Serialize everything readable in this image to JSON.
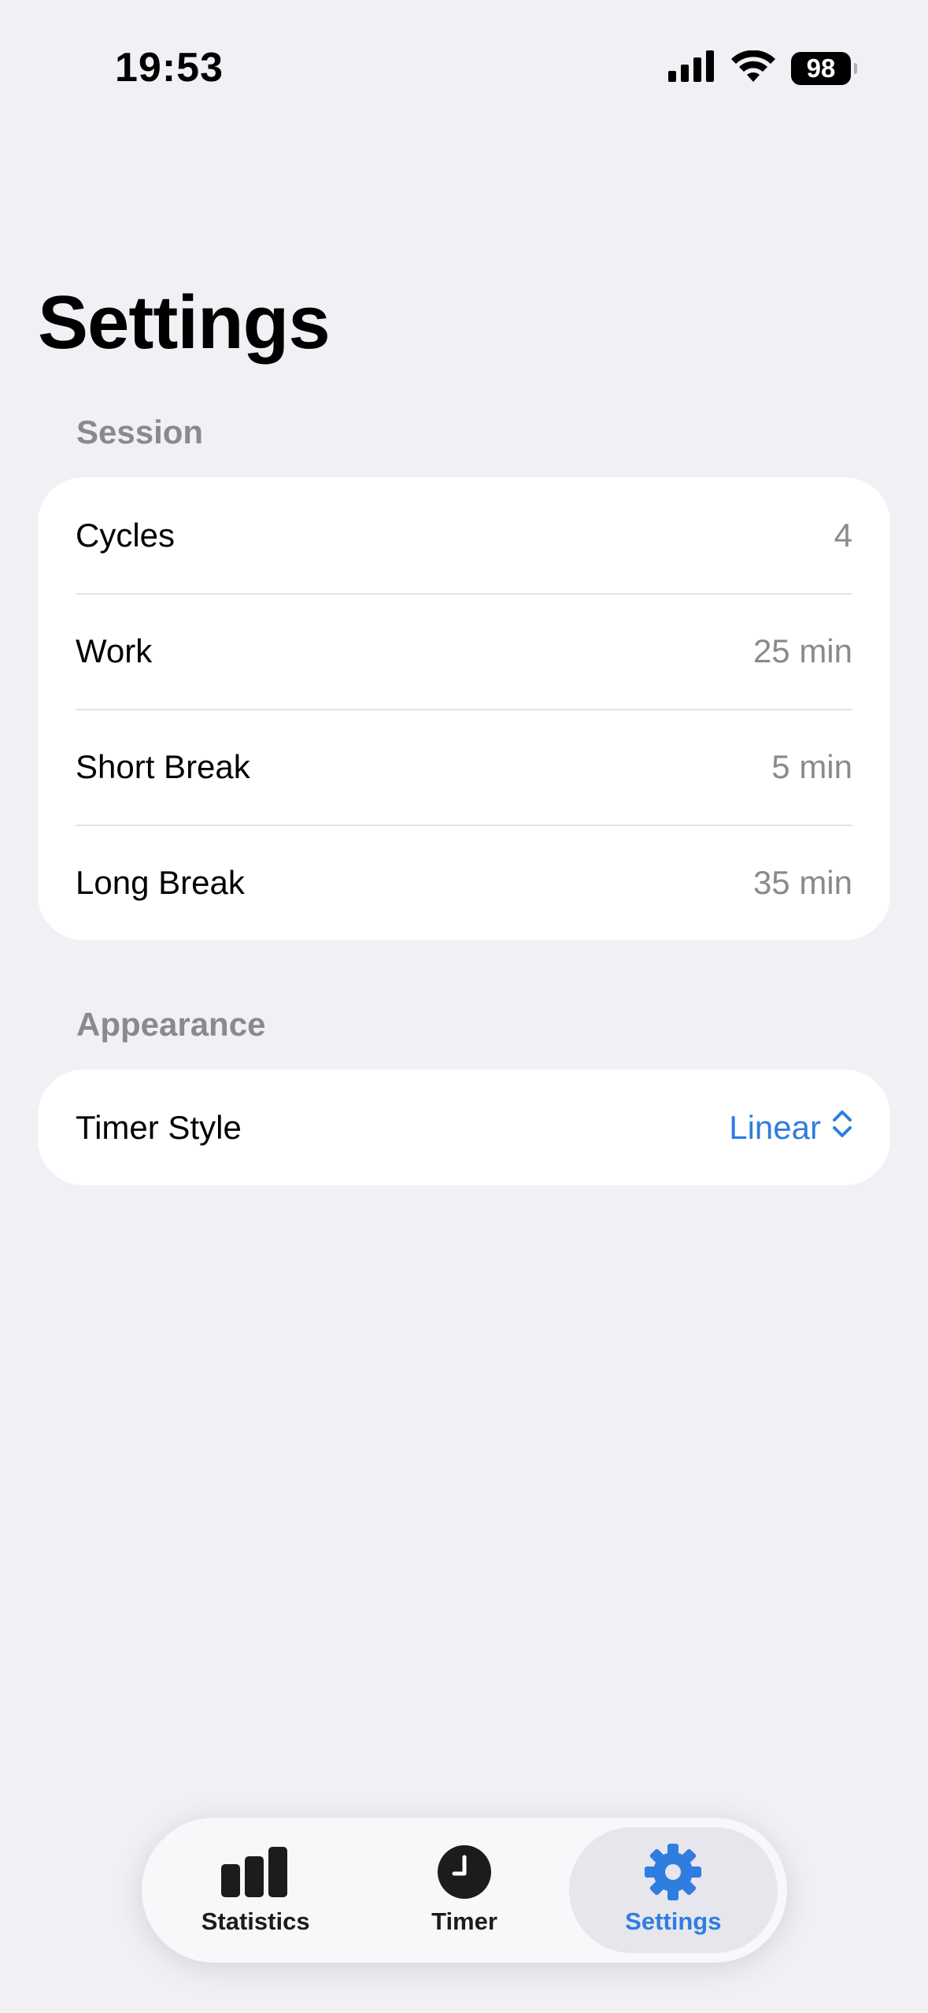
{
  "status_bar": {
    "time": "19:53",
    "battery": "98"
  },
  "page": {
    "title": "Settings"
  },
  "sections": {
    "session": {
      "header": "Session",
      "rows": [
        {
          "label": "Cycles",
          "value": "4"
        },
        {
          "label": "Work",
          "value": "25 min"
        },
        {
          "label": "Short Break",
          "value": "5 min"
        },
        {
          "label": "Long Break",
          "value": "35 min"
        }
      ]
    },
    "appearance": {
      "header": "Appearance",
      "rows": [
        {
          "label": "Timer Style",
          "value": "Linear"
        }
      ]
    }
  },
  "tab_bar": {
    "tabs": [
      {
        "label": "Statistics",
        "icon": "bar-chart-icon"
      },
      {
        "label": "Timer",
        "icon": "clock-icon"
      },
      {
        "label": "Settings",
        "icon": "gear-icon"
      }
    ],
    "selected": "Settings"
  },
  "colors": {
    "accent": "#2f7de0",
    "background": "#f0f0f5",
    "secondary_text": "#8a8a8e"
  }
}
